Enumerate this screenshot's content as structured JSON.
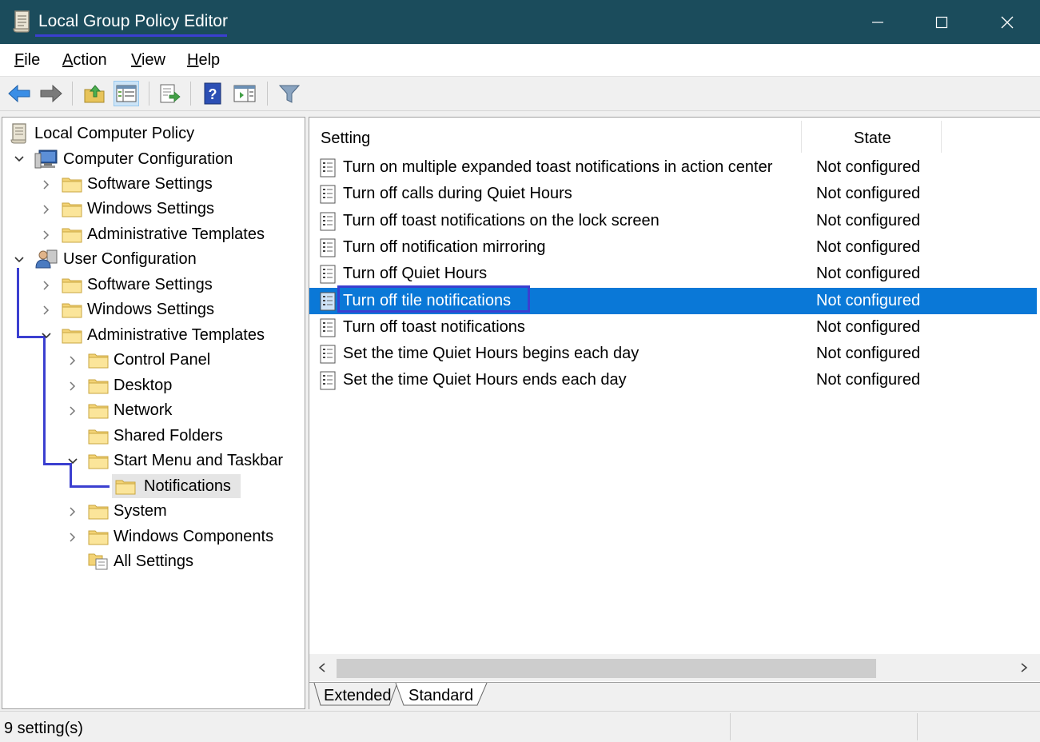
{
  "window": {
    "title": "Local Group Policy Editor"
  },
  "menu": {
    "file": "File",
    "action": "Action",
    "view": "View",
    "help": "Help"
  },
  "tree": {
    "root": "Local Computer Policy",
    "computer_config": "Computer Configuration",
    "cc_software": "Software Settings",
    "cc_windows": "Windows Settings",
    "cc_admin": "Administrative Templates",
    "user_config": "User Configuration",
    "uc_software": "Software Settings",
    "uc_windows": "Windows Settings",
    "uc_admin": "Administrative Templates",
    "control_panel": "Control Panel",
    "desktop": "Desktop",
    "network": "Network",
    "shared_folders": "Shared Folders",
    "start_menu": "Start Menu and Taskbar",
    "notifications": "Notifications",
    "system": "System",
    "windows_components": "Windows Components",
    "all_settings": "All Settings"
  },
  "list": {
    "col_setting": "Setting",
    "col_state": "State",
    "rows": [
      {
        "setting": "Turn on multiple expanded toast notifications in action center",
        "state": "Not configured"
      },
      {
        "setting": "Turn off calls during Quiet Hours",
        "state": "Not configured"
      },
      {
        "setting": "Turn off toast notifications on the lock screen",
        "state": "Not configured"
      },
      {
        "setting": "Turn off notification mirroring",
        "state": "Not configured"
      },
      {
        "setting": "Turn off Quiet Hours",
        "state": "Not configured"
      },
      {
        "setting": "Turn off tile notifications",
        "state": "Not configured"
      },
      {
        "setting": "Turn off toast notifications",
        "state": "Not configured"
      },
      {
        "setting": "Set the time Quiet Hours begins each day",
        "state": "Not configured"
      },
      {
        "setting": "Set the time Quiet Hours ends each day",
        "state": "Not configured"
      }
    ],
    "selected_index": 5
  },
  "tabs": {
    "extended": "Extended",
    "standard": "Standard"
  },
  "status": {
    "text": "9 setting(s)"
  },
  "colors": {
    "titlebar": "#1b4c5c",
    "selection": "#0a78d7",
    "annotation": "#3b3fd0"
  }
}
